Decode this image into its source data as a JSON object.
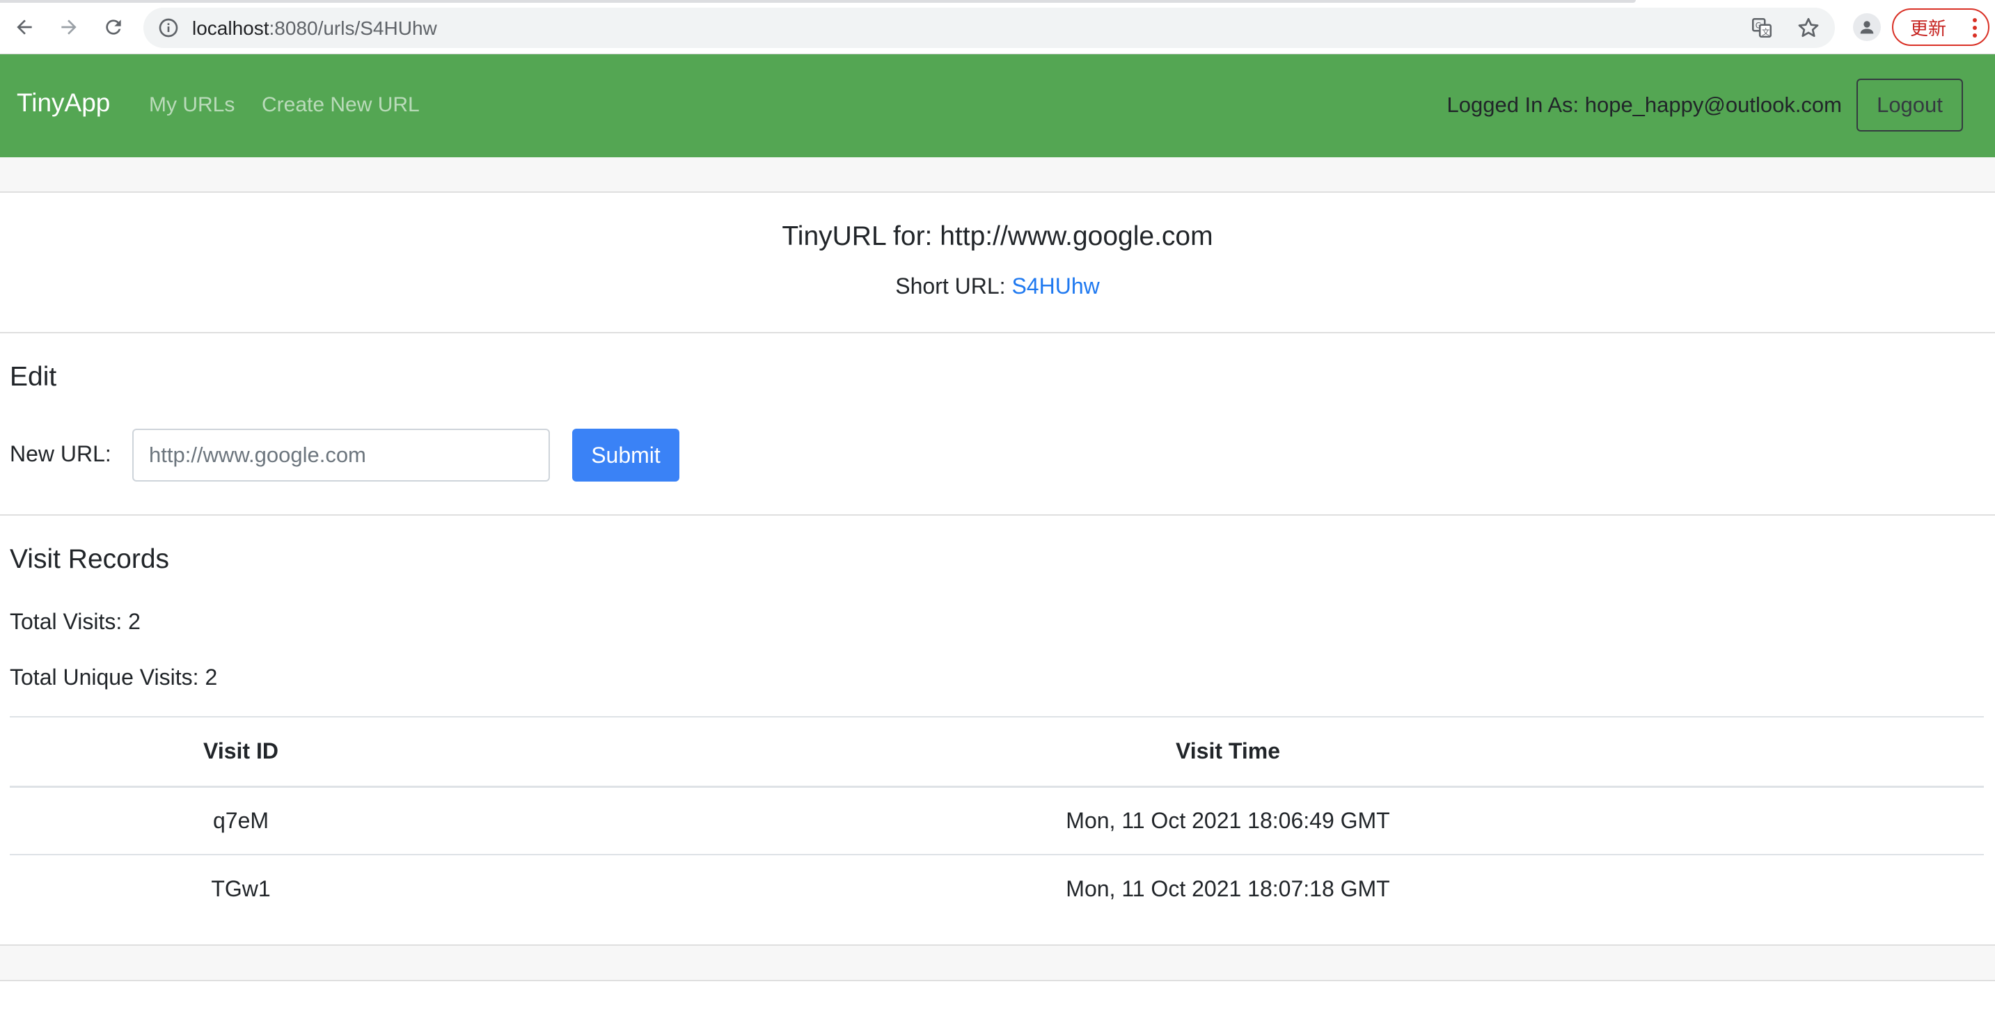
{
  "browser": {
    "url_host": "localhost",
    "url_path": ":8080/urls/S4HUhw",
    "update_label": "更新"
  },
  "navbar": {
    "brand": "TinyApp",
    "links": [
      "My URLs",
      "Create New URL"
    ],
    "logged_in_text": "Logged In As: hope_happy@outlook.com",
    "logout_label": "Logout",
    "background_color": "#54a653"
  },
  "url_info": {
    "title": "TinyURL for: http://www.google.com",
    "short_url_label": "Short URL: ",
    "short_url_value": "S4HUhw"
  },
  "edit": {
    "heading": "Edit",
    "new_url_label": "New URL:",
    "input_placeholder": "http://www.google.com",
    "submit_label": "Submit"
  },
  "visits": {
    "heading": "Visit Records",
    "total_visits": "Total Visits: 2",
    "total_unique_visits": "Total Unique Visits: 2",
    "columns": [
      "Visit ID",
      "Visit Time"
    ],
    "rows": [
      {
        "id": "q7eM",
        "time": "Mon, 11 Oct 2021 18:06:49 GMT"
      },
      {
        "id": "TGw1",
        "time": "Mon, 11 Oct 2021 18:07:18 GMT"
      }
    ]
  },
  "colors": {
    "primary_button": "#3a82f6",
    "link": "#1f79f0"
  }
}
